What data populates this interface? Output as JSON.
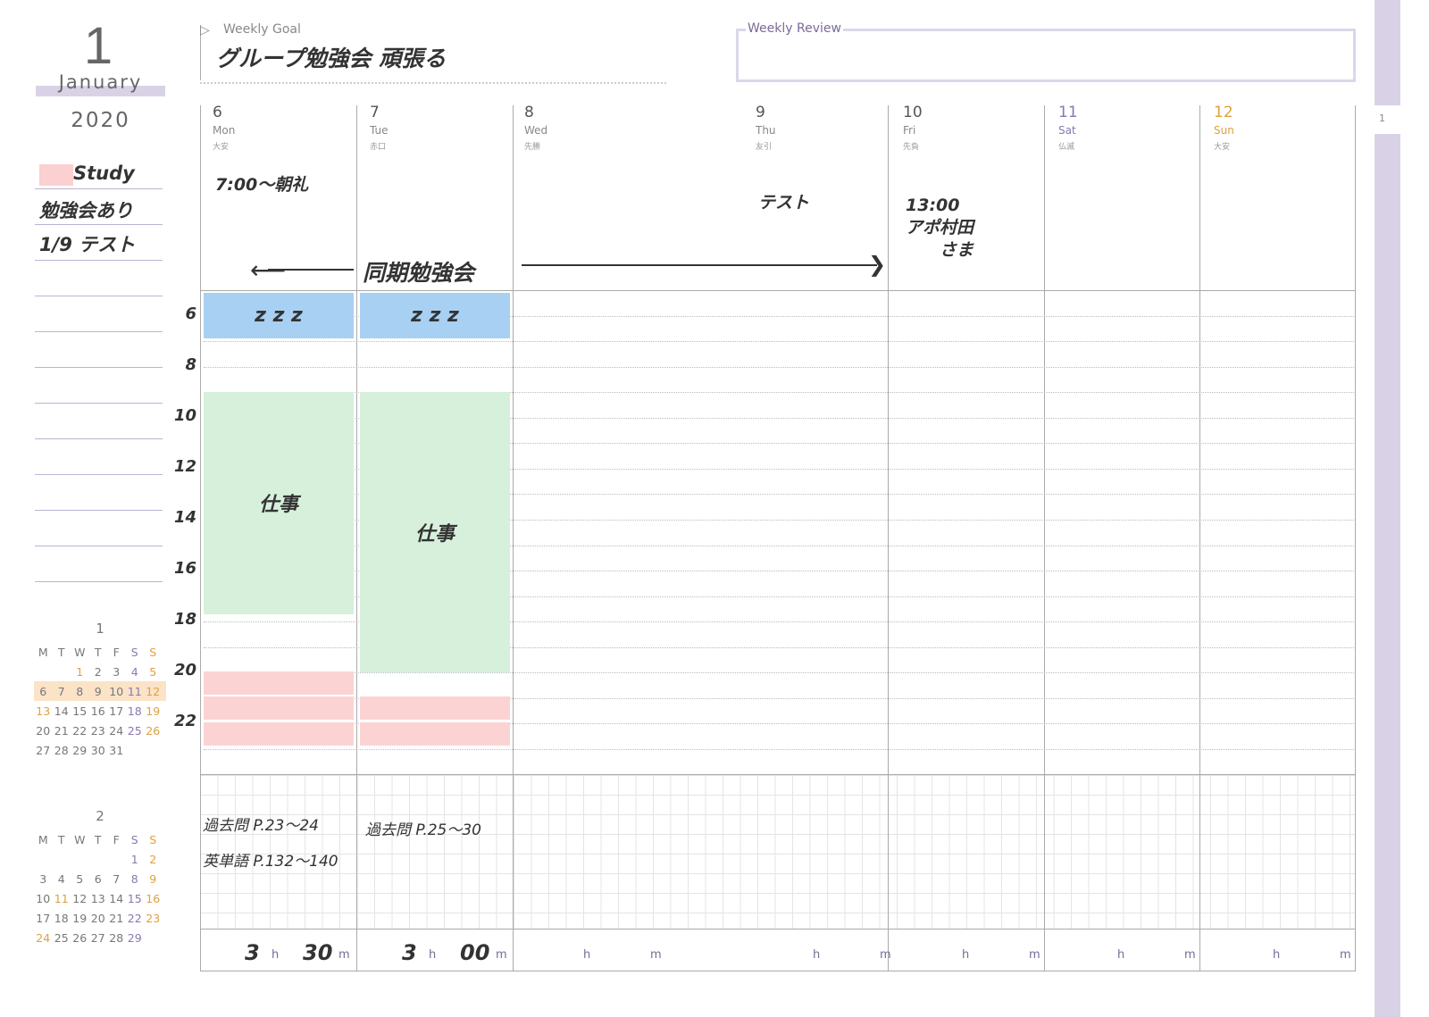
{
  "header": {
    "month_number": "1",
    "month_name": "January",
    "year": "2020"
  },
  "memo": {
    "items": [
      "Study",
      "勉強会あり",
      "1/9 テスト"
    ],
    "highlight_color": "#fbd0d0"
  },
  "mini_calendars": [
    {
      "title": "1",
      "weekdays": [
        "M",
        "T",
        "W",
        "T",
        "F",
        "S",
        "S"
      ],
      "weeks": [
        [
          "",
          "",
          "1",
          "2",
          "3",
          "4",
          "5"
        ],
        [
          "6",
          "7",
          "8",
          "9",
          "10",
          "11",
          "12"
        ],
        [
          "13",
          "14",
          "15",
          "16",
          "17",
          "18",
          "19"
        ],
        [
          "20",
          "21",
          "22",
          "23",
          "24",
          "25",
          "26"
        ],
        [
          "27",
          "28",
          "29",
          "30",
          "31",
          "",
          ""
        ]
      ],
      "holidays": [
        "1",
        "13"
      ],
      "current_week": 1
    },
    {
      "title": "2",
      "weekdays": [
        "M",
        "T",
        "W",
        "T",
        "F",
        "S",
        "S"
      ],
      "weeks": [
        [
          "",
          "",
          "",
          "",
          "",
          "1",
          "2"
        ],
        [
          "3",
          "4",
          "5",
          "6",
          "7",
          "8",
          "9"
        ],
        [
          "10",
          "11",
          "12",
          "13",
          "14",
          "15",
          "16"
        ],
        [
          "17",
          "18",
          "19",
          "20",
          "21",
          "22",
          "23"
        ],
        [
          "24",
          "25",
          "26",
          "27",
          "28",
          "29",
          ""
        ]
      ],
      "holidays": [
        "11",
        "24"
      ],
      "current_week": -1
    }
  ],
  "weekly_goal": {
    "label": "Weekly Goal",
    "text": "グループ勉強会 頑張る"
  },
  "weekly_review": {
    "label": "Weekly Review",
    "text": ""
  },
  "page_tab": "1",
  "days": [
    {
      "num": "6",
      "dow": "Mon",
      "rokuyo": "大安",
      "note": "7:00〜朝礼"
    },
    {
      "num": "7",
      "dow": "Tue",
      "rokuyo": "赤口",
      "note": ""
    },
    {
      "num": "8",
      "dow": "Wed",
      "rokuyo": "先勝",
      "note": ""
    },
    {
      "num": "9",
      "dow": "Thu",
      "rokuyo": "友引",
      "note": "テスト"
    },
    {
      "num": "10",
      "dow": "Fri",
      "rokuyo": "先負",
      "note": "13:00\nアポ村田\n　　さま"
    },
    {
      "num": "11",
      "dow": "Sat",
      "rokuyo": "仏滅",
      "note": ""
    },
    {
      "num": "12",
      "dow": "Sun",
      "rokuyo": "大安",
      "note": ""
    }
  ],
  "span_event": "同期勉強会",
  "hour_labels": [
    "6",
    "8",
    "10",
    "12",
    "14",
    "16",
    "18",
    "20",
    "22"
  ],
  "time_blocks": [
    {
      "day": 0,
      "start": 5.1,
      "end": 6.9,
      "color": "#a8d0f2",
      "label": "z z z"
    },
    {
      "day": 1,
      "start": 5.1,
      "end": 6.9,
      "color": "#a8d0f2",
      "label": "z z z"
    },
    {
      "day": 0,
      "start": 9,
      "end": 17.7,
      "color": "#d6f0dc",
      "label": "仕事"
    },
    {
      "day": 1,
      "start": 9,
      "end": 20,
      "color": "#d6f0dc",
      "label": "仕事"
    },
    {
      "day": 0,
      "start": 19.95,
      "end": 20.85,
      "color": "#fcd3d3",
      "label": ""
    },
    {
      "day": 0,
      "start": 20.95,
      "end": 21.85,
      "color": "#fcd3d3",
      "label": ""
    },
    {
      "day": 0,
      "start": 21.95,
      "end": 22.85,
      "color": "#fcd3d3",
      "label": ""
    },
    {
      "day": 1,
      "start": 20.95,
      "end": 21.85,
      "color": "#fcd3d3",
      "label": ""
    },
    {
      "day": 1,
      "start": 21.95,
      "end": 22.85,
      "color": "#fcd3d3",
      "label": ""
    }
  ],
  "study_notes": [
    [
      "過去問 P.23〜24",
      "英単語 P.132〜140"
    ],
    [
      "過去問 P.25〜30"
    ]
  ],
  "study_time": [
    {
      "h": "3",
      "m": "30"
    },
    {
      "h": "3",
      "m": "00"
    },
    {
      "h": "",
      "m": ""
    },
    {
      "h": "",
      "m": ""
    },
    {
      "h": "",
      "m": ""
    },
    {
      "h": "",
      "m": ""
    },
    {
      "h": "",
      "m": ""
    }
  ],
  "units": {
    "h": "h",
    "m": "m"
  },
  "colors": {
    "saturday": "#8a78b0",
    "sunday": "#e0a040",
    "accent_lavender": "#d9d2e6"
  }
}
